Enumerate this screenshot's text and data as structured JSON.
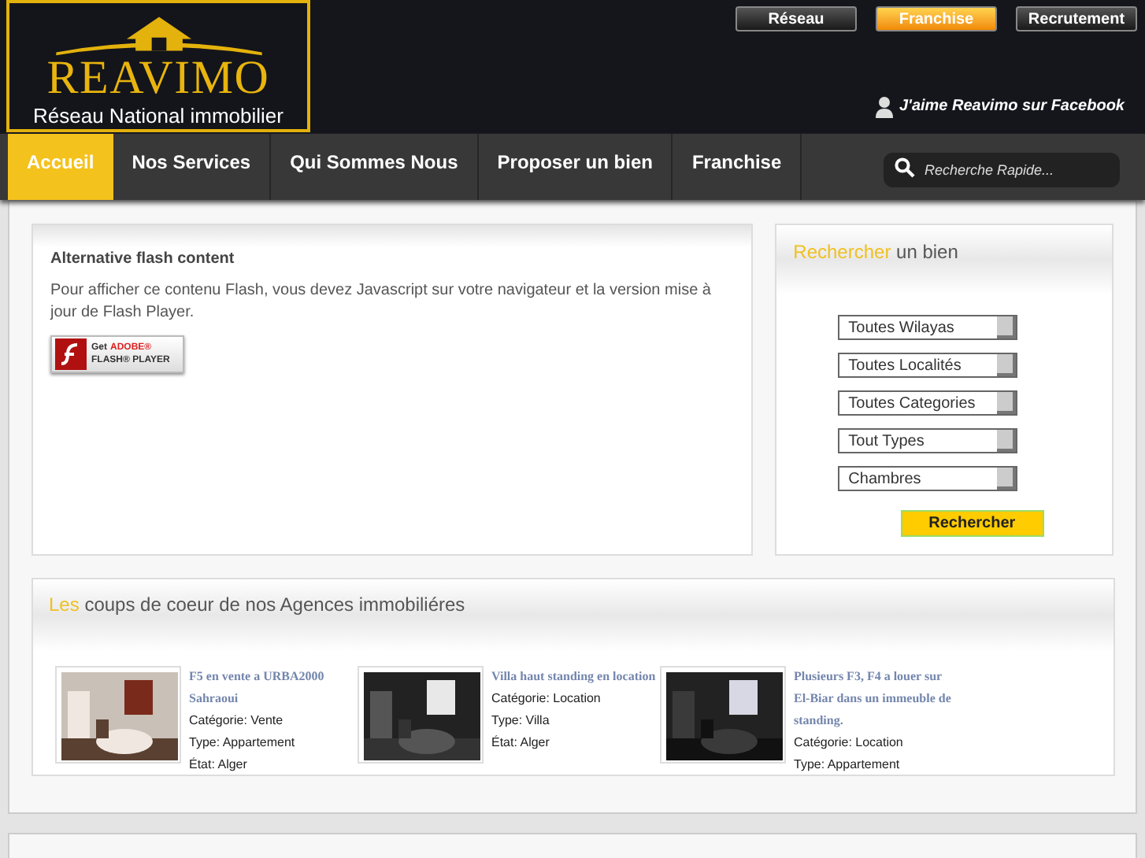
{
  "logo": {
    "name": "REAVIMO",
    "tagline": "Réseau National immobilier"
  },
  "top_buttons": [
    {
      "label": "Réseau",
      "selected": false
    },
    {
      "label": "Franchise",
      "selected": true
    },
    {
      "label": "Recrutement",
      "selected": false
    }
  ],
  "facebook_link": "J'aime Reavimo sur Facebook",
  "nav": [
    {
      "label": "Accueil",
      "selected": true
    },
    {
      "label": "Nos Services",
      "selected": false
    },
    {
      "label": "Qui Sommes Nous",
      "selected": false
    },
    {
      "label": "Proposer un bien",
      "selected": false
    },
    {
      "label": "Franchise",
      "selected": false
    }
  ],
  "search": {
    "placeholder": "Recherche Rapide..."
  },
  "flash": {
    "title": "Alternative flash content",
    "text": "Pour afficher ce contenu Flash, vous devez Javascript sur votre navigateur et la version mise à jour de Flash Player.",
    "badge": {
      "get": "Get",
      "brand": "ADOBE®",
      "product": "FLASH® PLAYER"
    }
  },
  "search_panel": {
    "title_highlight": "Rechercher",
    "title_rest": "un bien",
    "selects": [
      "Toutes Wilayas",
      "Toutes Localités",
      "Toutes Categories",
      "Tout Types",
      "Chambres"
    ],
    "button": "Rechercher"
  },
  "featured": {
    "title_highlight": "Les",
    "title_rest": "coups de coeur de nos Agences immobiliéres",
    "listings": [
      {
        "title": "F5 en vente a URBA2000 Sahraoui",
        "details": [
          "Catégorie: Vente",
          "Type: Appartement",
          "État: Alger"
        ]
      },
      {
        "title": "Villa haut standing en location",
        "details": [
          "Catégorie: Location",
          "Type: Villa",
          "État: Alger"
        ]
      },
      {
        "title": "Plusieurs F3, F4 a louer sur El-Biar dans un immeuble de standing.",
        "details": [
          "Catégorie: Location",
          "Type: Appartement"
        ]
      }
    ]
  }
}
